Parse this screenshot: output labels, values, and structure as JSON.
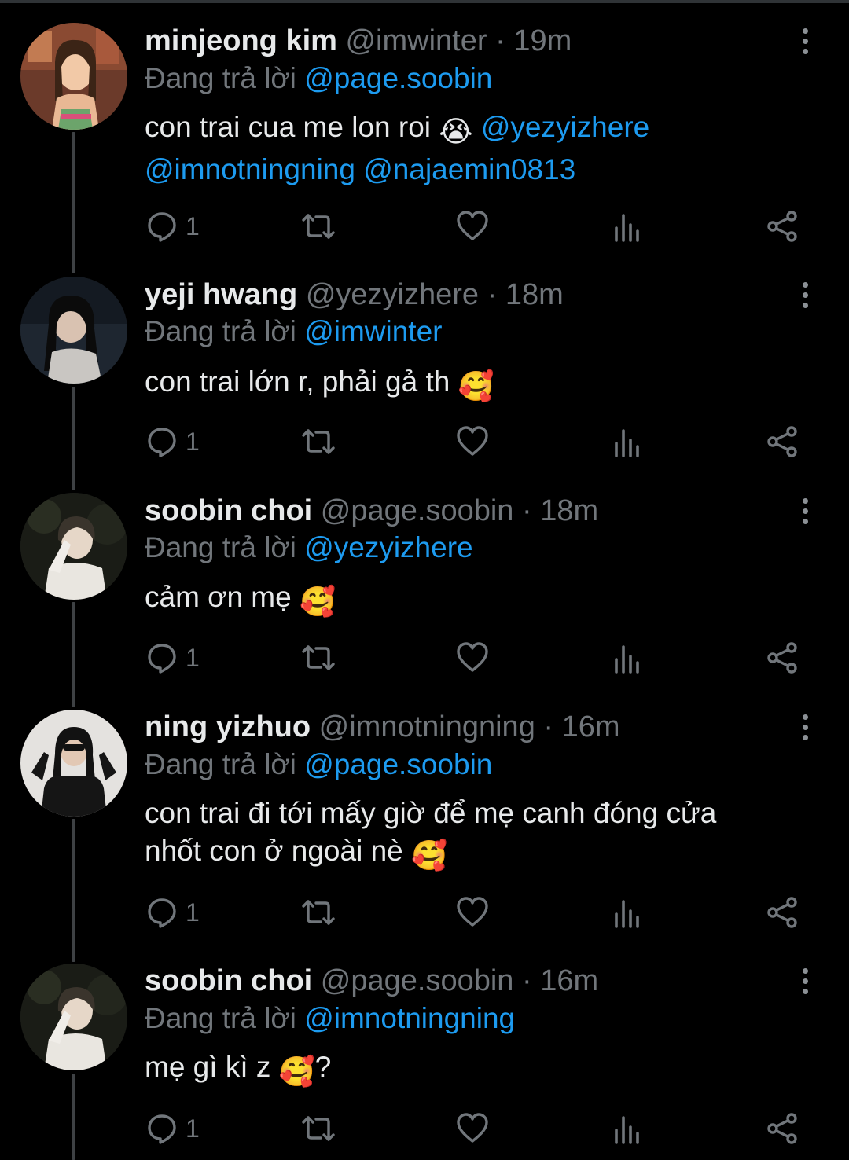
{
  "replying_prefix": "Đang trả lời",
  "colors": {
    "background": "#000000",
    "text": "#e7e9ea",
    "muted": "#71767b",
    "accent": "#1d9bf0",
    "thread_line": "#3e4144"
  },
  "icons": {
    "reply": "reply-icon",
    "retweet": "retweet-icon",
    "like": "heart-icon",
    "views": "views-icon",
    "share": "share-icon",
    "more": "more-vertical-icon"
  },
  "tweets": [
    {
      "name": "minjeong kim",
      "handle": "@imwinter",
      "separator": "·",
      "time": "19m",
      "replying_to": "@page.soobin",
      "text_line1_plain": "con trai cua me lon roi",
      "text_line1_emoji": "😭",
      "text_line1_mention": "@yezyizhere",
      "text_line2_mention_a": "@imnotningning",
      "text_line2_mention_b": "@najaemin0813",
      "reply_count": "1"
    },
    {
      "name": "yeji hwang",
      "handle": "@yezyizhere",
      "separator": "·",
      "time": "18m",
      "replying_to": "@imwinter",
      "text": "con trai lớn r, phải gả th",
      "emoji": "🥰",
      "reply_count": "1"
    },
    {
      "name": "soobin choi",
      "handle": "@page.soobin",
      "separator": "·",
      "time": "18m",
      "replying_to": "@yezyizhere",
      "text": "cảm ơn mẹ",
      "emoji": "🥰",
      "reply_count": "1"
    },
    {
      "name": "ning yizhuo",
      "handle": "@imnotningning",
      "separator": "·",
      "time": "16m",
      "replying_to": "@page.soobin",
      "text_line1": "con trai đi tới mấy giờ để mẹ canh đóng cửa",
      "text_line2": "nhốt con ở ngoài nè",
      "emoji": "🥰",
      "reply_count": "1"
    },
    {
      "name": "soobin choi",
      "handle": "@page.soobin",
      "separator": "·",
      "time": "16m",
      "replying_to": "@imnotningning",
      "text": "mẹ gì kì z",
      "emoji": "🥰",
      "text_suffix": "?",
      "reply_count": "1"
    }
  ]
}
